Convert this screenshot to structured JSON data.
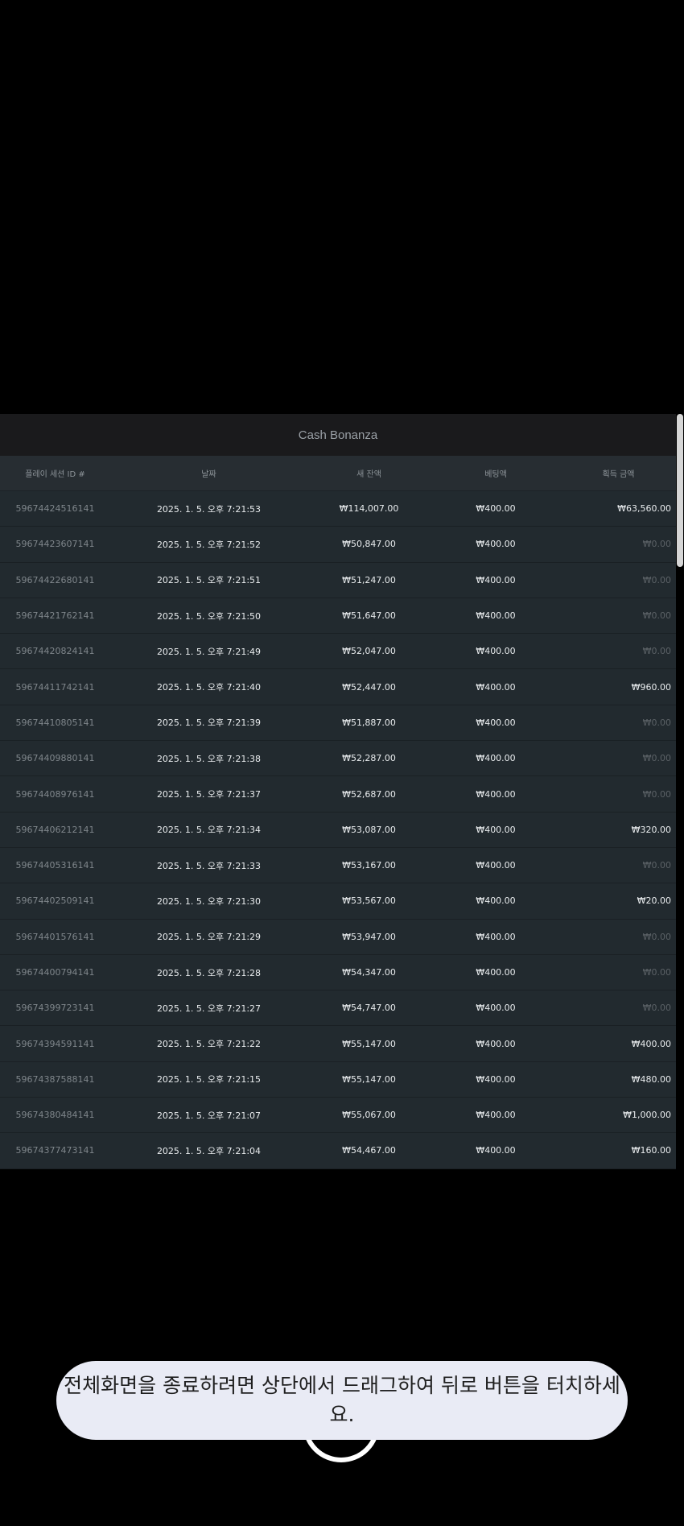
{
  "title": "Cash Bonanza",
  "columns": [
    "플레이 세션 ID #",
    "날짜",
    "새 잔액",
    "베팅액",
    "획득 금액"
  ],
  "rows": [
    {
      "id": "59674424516141",
      "date": "2025. 1. 5. 오후 7:21:53",
      "balance": "₩114,007.00",
      "bet": "₩400.00",
      "win": "₩63,560.00"
    },
    {
      "id": "59674423607141",
      "date": "2025. 1. 5. 오후 7:21:52",
      "balance": "₩50,847.00",
      "bet": "₩400.00",
      "win": "₩0.00"
    },
    {
      "id": "59674422680141",
      "date": "2025. 1. 5. 오후 7:21:51",
      "balance": "₩51,247.00",
      "bet": "₩400.00",
      "win": "₩0.00"
    },
    {
      "id": "59674421762141",
      "date": "2025. 1. 5. 오후 7:21:50",
      "balance": "₩51,647.00",
      "bet": "₩400.00",
      "win": "₩0.00"
    },
    {
      "id": "59674420824141",
      "date": "2025. 1. 5. 오후 7:21:49",
      "balance": "₩52,047.00",
      "bet": "₩400.00",
      "win": "₩0.00"
    },
    {
      "id": "59674411742141",
      "date": "2025. 1. 5. 오후 7:21:40",
      "balance": "₩52,447.00",
      "bet": "₩400.00",
      "win": "₩960.00"
    },
    {
      "id": "59674410805141",
      "date": "2025. 1. 5. 오후 7:21:39",
      "balance": "₩51,887.00",
      "bet": "₩400.00",
      "win": "₩0.00"
    },
    {
      "id": "59674409880141",
      "date": "2025. 1. 5. 오후 7:21:38",
      "balance": "₩52,287.00",
      "bet": "₩400.00",
      "win": "₩0.00"
    },
    {
      "id": "59674408976141",
      "date": "2025. 1. 5. 오후 7:21:37",
      "balance": "₩52,687.00",
      "bet": "₩400.00",
      "win": "₩0.00"
    },
    {
      "id": "59674406212141",
      "date": "2025. 1. 5. 오후 7:21:34",
      "balance": "₩53,087.00",
      "bet": "₩400.00",
      "win": "₩320.00"
    },
    {
      "id": "59674405316141",
      "date": "2025. 1. 5. 오후 7:21:33",
      "balance": "₩53,167.00",
      "bet": "₩400.00",
      "win": "₩0.00"
    },
    {
      "id": "59674402509141",
      "date": "2025. 1. 5. 오후 7:21:30",
      "balance": "₩53,567.00",
      "bet": "₩400.00",
      "win": "₩20.00"
    },
    {
      "id": "59674401576141",
      "date": "2025. 1. 5. 오후 7:21:29",
      "balance": "₩53,947.00",
      "bet": "₩400.00",
      "win": "₩0.00"
    },
    {
      "id": "59674400794141",
      "date": "2025. 1. 5. 오후 7:21:28",
      "balance": "₩54,347.00",
      "bet": "₩400.00",
      "win": "₩0.00"
    },
    {
      "id": "59674399723141",
      "date": "2025. 1. 5. 오후 7:21:27",
      "balance": "₩54,747.00",
      "bet": "₩400.00",
      "win": "₩0.00"
    },
    {
      "id": "59674394591141",
      "date": "2025. 1. 5. 오후 7:21:22",
      "balance": "₩55,147.00",
      "bet": "₩400.00",
      "win": "₩400.00"
    },
    {
      "id": "59674387588141",
      "date": "2025. 1. 5. 오후 7:21:15",
      "balance": "₩55,147.00",
      "bet": "₩400.00",
      "win": "₩480.00"
    },
    {
      "id": "59674380484141",
      "date": "2025. 1. 5. 오후 7:21:07",
      "balance": "₩55,067.00",
      "bet": "₩400.00",
      "win": "₩1,000.00"
    },
    {
      "id": "59674377473141",
      "date": "2025. 1. 5. 오후 7:21:04",
      "balance": "₩54,467.00",
      "bet": "₩400.00",
      "win": "₩160.00"
    }
  ],
  "toast": "전체화면을 종료하려면 상단에서 드래그하여 뒤로 버튼을 터치하세요."
}
